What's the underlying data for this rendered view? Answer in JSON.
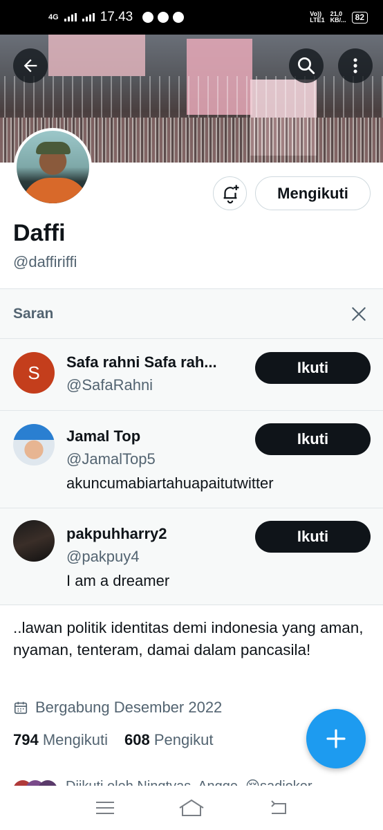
{
  "status_bar": {
    "time": "17.43",
    "network": "4G",
    "data_speed": "21,0",
    "data_unit": "KB/...",
    "volte": "Vo))",
    "lte": "LTE1",
    "battery": "82"
  },
  "profile": {
    "name": "Daffi",
    "handle": "@daffiriffi",
    "following_button": "Mengikuti",
    "bio": "..lawan politik identitas demi indonesia yang aman, nyaman, tenteram, damai dalam pancasila!",
    "joined": "Bergabung Desember 2022",
    "following_count": "794",
    "following_label": "Mengikuti",
    "followers_count": "608",
    "followers_label": "Pengikut",
    "followed_by": "Diikuti oleh Ningtyas, Angge, 😔sadjoker"
  },
  "suggestions": {
    "title": "Saran",
    "items": [
      {
        "avatar_letter": "S",
        "avatar_color": "#c43e1c",
        "name": "Safa rahni Safa rah...",
        "handle": "@SafaRahni",
        "bio": "",
        "button": "Ikuti"
      },
      {
        "name": "Jamal Top",
        "handle": "@JamalTop5",
        "bio": "akuncumabiartahuapaitutwitter",
        "button": "Ikuti"
      },
      {
        "name": "pakpuhharry2",
        "handle": "@pakpuy4",
        "bio": "I am a dreamer",
        "button": "Ikuti"
      }
    ]
  },
  "colors": {
    "accent": "#1d9bf0",
    "text_primary": "#0f1419",
    "text_secondary": "#536471",
    "button_dark": "#0f1419"
  },
  "icons": [
    "back-arrow-icon",
    "search-icon",
    "more-vertical-icon",
    "bell-plus-icon",
    "close-icon",
    "calendar-icon",
    "plus-icon",
    "menu-icon",
    "home-icon",
    "back-icon"
  ]
}
